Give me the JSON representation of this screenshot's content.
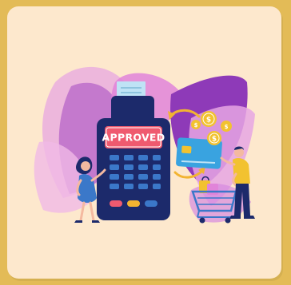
{
  "colors": {
    "frame": "#e3bb57",
    "card": "#fde8cd",
    "leaf_purple": "#8e3ab8",
    "leaf_pink": "#e184d9",
    "terminal": "#1c2a6b",
    "screen": "#ef5a6f",
    "coin": "#f2c230",
    "card_blue": "#39a3e0"
  },
  "terminal": {
    "status_text": "APPROVED"
  },
  "coins": [
    {
      "symbol": "$"
    },
    {
      "symbol": "$"
    },
    {
      "symbol": "$"
    },
    {
      "symbol": "$"
    }
  ]
}
